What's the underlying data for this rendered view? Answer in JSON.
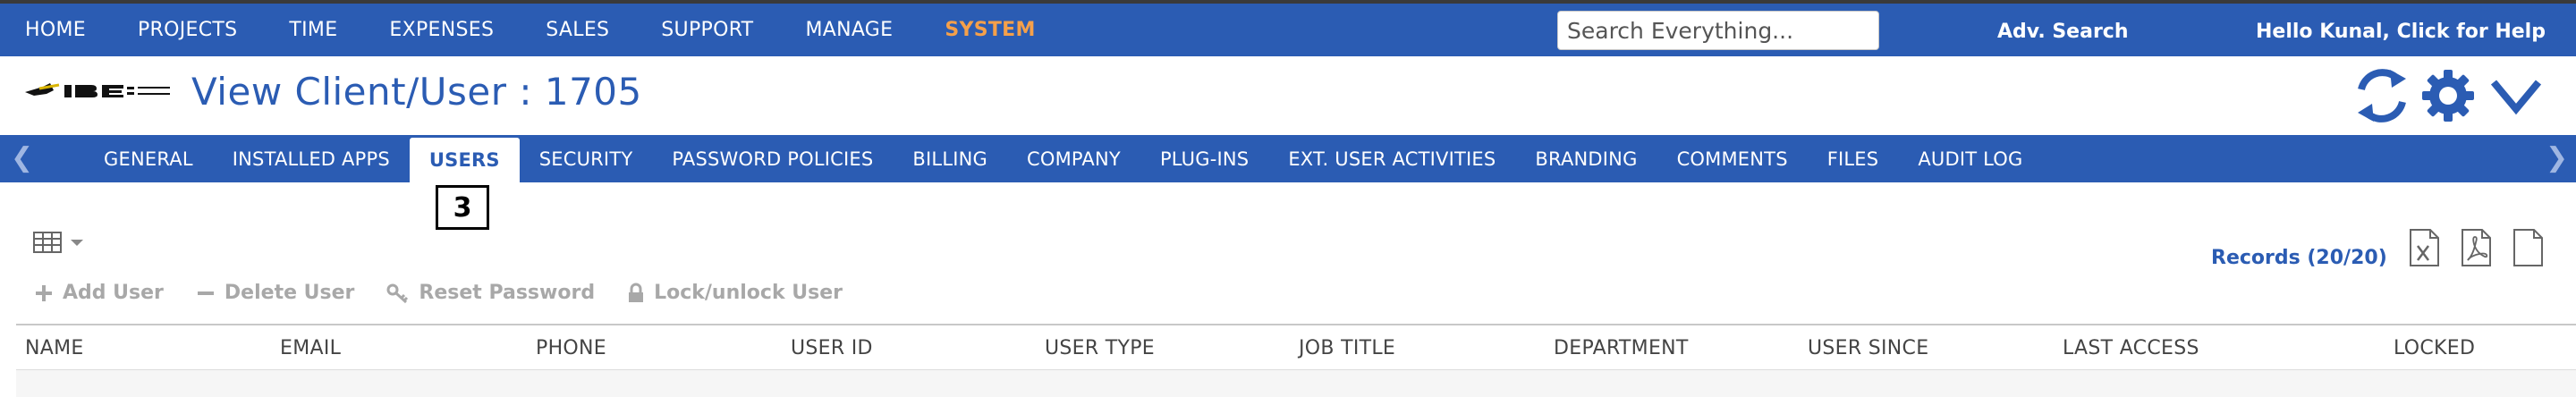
{
  "topnav": {
    "items": [
      "HOME",
      "PROJECTS",
      "TIME",
      "EXPENSES",
      "SALES",
      "SUPPORT",
      "MANAGE",
      "SYSTEM"
    ],
    "active": "SYSTEM",
    "search_placeholder": "Search Everything...",
    "adv_search": "Adv. Search",
    "greeting": "Hello Kunal, Click for Help"
  },
  "header": {
    "title": "View Client/User : 1705",
    "icons": [
      "refresh-icon",
      "gear-icon",
      "chevron-down-icon"
    ]
  },
  "tabs": {
    "items": [
      "GENERAL",
      "INSTALLED APPS",
      "USERS",
      "SECURITY",
      "PASSWORD POLICIES",
      "BILLING",
      "COMPANY",
      "PLUG-INS",
      "EXT. USER ACTIVITIES",
      "BRANDING",
      "COMMENTS",
      "FILES",
      "AUDIT LOG"
    ],
    "active": "USERS",
    "annotation": "3"
  },
  "toolbar": {
    "records": "Records (20/20)",
    "actions": [
      "Add User",
      "Delete User",
      "Reset Password",
      "Lock/unlock User"
    ],
    "export_icons": [
      "excel-icon",
      "pdf-icon",
      "document-icon"
    ]
  },
  "table": {
    "columns": [
      "NAME",
      "EMAIL",
      "PHONE",
      "USER ID",
      "USER TYPE",
      "JOB TITLE",
      "DEPARTMENT",
      "USER SINCE",
      "LAST ACCESS",
      "LOCKED"
    ]
  },
  "colors": {
    "primary": "#2b5cb3",
    "accent": "#f5a04a",
    "disabled": "#a8a8a8"
  }
}
